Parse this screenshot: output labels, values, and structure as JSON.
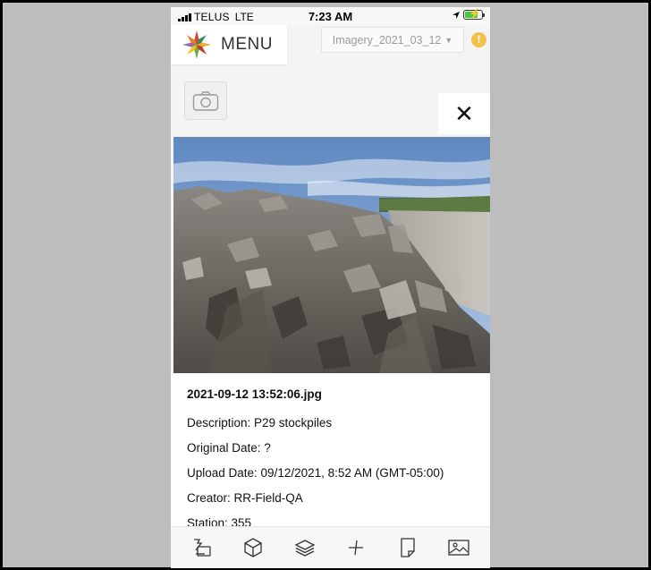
{
  "status_bar": {
    "carrier": "TELUS",
    "network": "LTE",
    "time": "7:23 AM",
    "battery_charging": true
  },
  "header": {
    "menu_label": "MENU",
    "imagery_selected": "Imagery_2021_03_12",
    "warning_symbol": "!"
  },
  "photo_panel": {
    "close_symbol": "✕",
    "filename": "2021-09-12 13:52:06.jpg",
    "description": "Description: P29 stockpiles",
    "original_date": "Original Date: ?",
    "upload_date": "Upload Date: 09/12/2021, 8:52 AM (GMT-05:00)",
    "creator": "Creator: RR-Field-QA",
    "station": "Station: 355"
  },
  "toolbar": {
    "icons": [
      "measure-tool-icon",
      "cube-3d-icon",
      "layers-icon",
      "crosshair-icon",
      "document-icon",
      "image-icon"
    ]
  },
  "colors": {
    "warning": "#f3c14a",
    "battery": "#44c944",
    "panel_bg": "#ffffff",
    "map_bg": "#f4f4f4"
  }
}
